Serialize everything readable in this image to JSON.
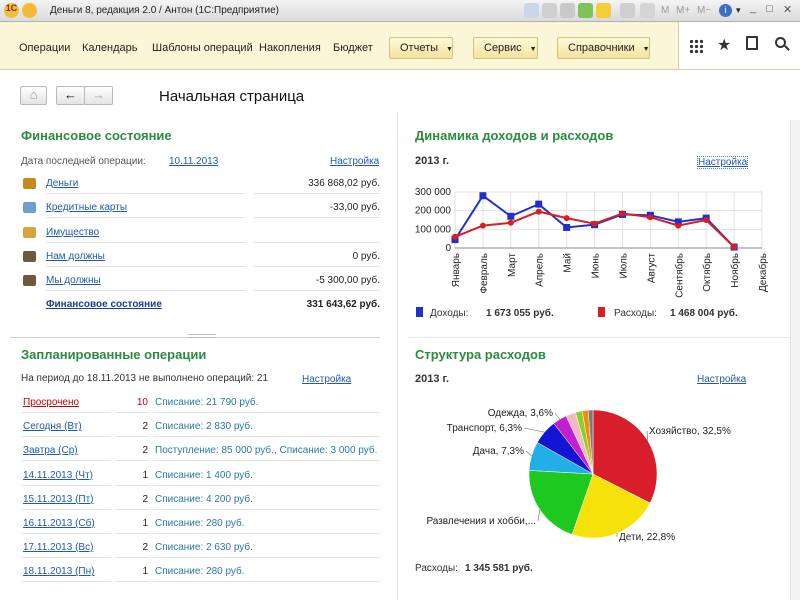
{
  "window": {
    "title": "Деньги 8, редакция 2.0 / Антон (1С:Предприятие)"
  },
  "menu": {
    "items": [
      "Операции",
      "Календарь",
      "Шаблоны операций",
      "Накопления",
      "Бюджет"
    ],
    "dropdowns": [
      "Отчеты",
      "Сервис",
      "Справочники"
    ]
  },
  "nav": {
    "page_title": "Начальная страница"
  },
  "fin": {
    "title": "Финансовое состояние",
    "last_op_label": "Дата последней операции:",
    "last_op_date": "10.11.2013",
    "settings": "Настройка",
    "rows": [
      {
        "label": "Деньги",
        "value": "336 868,02 руб.",
        "icon": "wallet-icon",
        "color": "#c98a1b"
      },
      {
        "label": "Кредитные карты",
        "value": "-33,00 руб.",
        "icon": "card-icon",
        "color": "#6a9fd1"
      },
      {
        "label": "Имущество",
        "value": "",
        "icon": "house-icon",
        "color": "#d8a33b"
      },
      {
        "label": "Нам должны",
        "value": "0 руб.",
        "icon": "person-in-icon",
        "color": "#6d5a3a"
      },
      {
        "label": "Мы должны",
        "value": "-5 300,00 руб.",
        "icon": "person-out-icon",
        "color": "#6d5a3a"
      }
    ],
    "total_label": "Финансовое состояние",
    "total_value": "331 643,62 руб."
  },
  "planned": {
    "title": "Запланированные операции",
    "period_text": "На период до 18.11.2013 не выполнено операций: 21",
    "settings": "Настройка",
    "rows": [
      {
        "label": "Просрочено",
        "count": "10",
        "desc": "Списание: 21 790 руб.",
        "red": true
      },
      {
        "label": "Сегодня (Вт)",
        "count": "2",
        "desc": "Списание: 2 830 руб.",
        "red": false
      },
      {
        "label": "Завтра (Ср)",
        "count": "2",
        "desc": "Поступление: 85 000 руб., Списание: 3 000 руб.",
        "red": false
      },
      {
        "label": "14.11.2013 (Чт)",
        "count": "1",
        "desc": "Списание: 1 400 руб.",
        "red": false
      },
      {
        "label": "15.11.2013 (Пт)",
        "count": "2",
        "desc": "Списание: 4 200 руб.",
        "red": false
      },
      {
        "label": "16.11.2013 (Сб)",
        "count": "1",
        "desc": "Списание: 280 руб.",
        "red": false
      },
      {
        "label": "17.11.2013 (Вс)",
        "count": "2",
        "desc": "Списание: 2 630 руб.",
        "red": false
      },
      {
        "label": "18.11.2013 (Пн)",
        "count": "1",
        "desc": "Списание: 280 руб.",
        "red": false
      }
    ]
  },
  "dyn": {
    "title": "Динамика доходов и расходов",
    "year": "2013 г.",
    "settings": "Настройка",
    "income_label": "Доходы:",
    "income_value": "1 673 055 руб.",
    "expense_label": "Расходы:",
    "expense_value": "1 468 004 руб.",
    "income_color": "#1f2fd0",
    "expense_color": "#d81e1e"
  },
  "struct": {
    "title": "Структура расходов",
    "year": "2013 г.",
    "settings": "Настройка",
    "total_label": "Расходы:",
    "total_value": "1 345 581 руб."
  },
  "chart_data": [
    {
      "type": "line",
      "title": "",
      "categories": [
        "Январь",
        "Февраль",
        "Март",
        "Апрель",
        "Май",
        "Июнь",
        "Июль",
        "Август",
        "Сентябрь",
        "Октябрь",
        "Ноябрь",
        "Декабрь"
      ],
      "yticks": [
        "0",
        "100 000",
        "200 000",
        "300 000"
      ],
      "ylim": [
        0,
        300000
      ],
      "grid": true,
      "series": [
        {
          "name": "Доходы",
          "color": "#1f2fd0",
          "values": [
            45000,
            280000,
            170000,
            235000,
            110000,
            125000,
            180000,
            175000,
            140000,
            160000,
            5000,
            null
          ]
        },
        {
          "name": "Расходы",
          "color": "#d81e1e",
          "values": [
            60000,
            120000,
            135000,
            195000,
            160000,
            130000,
            185000,
            165000,
            120000,
            150000,
            5000,
            null
          ]
        }
      ]
    },
    {
      "type": "pie",
      "title": "",
      "slices": [
        {
          "label": "Хозяйство, 32,5%",
          "value": 32.5,
          "color": "#d81e2a"
        },
        {
          "label": "Дети, 22,8%",
          "value": 22.8,
          "color": "#f4e20a"
        },
        {
          "label": "Развлечения и хобби,...",
          "value": 20.6,
          "color": "#1ec81e"
        },
        {
          "label": "Дача, 7,3%",
          "value": 7.3,
          "color": "#22aee6"
        },
        {
          "label": "Транспорт, 6,3%",
          "value": 6.3,
          "color": "#1414d4"
        },
        {
          "label": "Одежда, 3,6%",
          "value": 3.6,
          "color": "#c21ed2"
        },
        {
          "label": "",
          "value": 2.5,
          "color": "#f2b8c4"
        },
        {
          "label": "",
          "value": 1.7,
          "color": "#88d224"
        },
        {
          "label": "",
          "value": 1.5,
          "color": "#f38a12"
        },
        {
          "label": "",
          "value": 1.2,
          "color": "#7a7a7a"
        }
      ]
    }
  ]
}
